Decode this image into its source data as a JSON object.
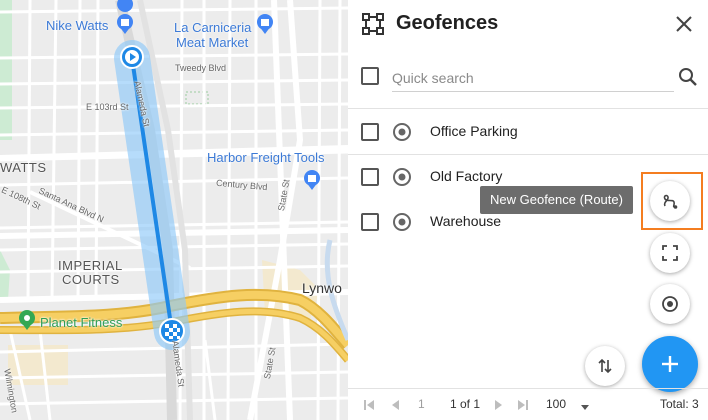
{
  "map": {
    "poi": {
      "nike": "Nike Watts",
      "carniceria_line1": "La Carniceria",
      "carniceria_line2": "Meat Market",
      "harbor": "Harbor Freight Tools",
      "planet": "Planet Fitness"
    },
    "areas": {
      "watts": "WATTS",
      "imperial_line1": "IMPERIAL",
      "imperial_line2": "COURTS",
      "lynwood": "Lynwo"
    },
    "streets": {
      "tweedy": "Tweedy Blvd",
      "e103": "E 103rd St",
      "century": "Century Blvd",
      "state1": "State St",
      "state2": "State St",
      "e108": "E 108th St",
      "santa_ana": "Santa Ana Blvd N",
      "wilmington": "Wilmington",
      "alameda_top": "Alameda St",
      "alameda_bottom": "Alameda St"
    },
    "route_color": "#1e88e5",
    "route_buffer_color": "#90caf9"
  },
  "panel": {
    "title": "Geofences",
    "search": {
      "placeholder": "Quick search",
      "value": ""
    },
    "items": [
      {
        "name": "Office Parking"
      },
      {
        "name": "Old Factory"
      },
      {
        "name": "Warehouse"
      }
    ],
    "tooltip": "New Geofence (Route)",
    "icons": {
      "header": "geofence-polygon-icon",
      "close": "close-icon",
      "search": "search-icon",
      "route": "route-icon",
      "fullscreen": "fullscreen-icon",
      "target": "target-icon",
      "add": "add-icon",
      "sort": "sort-icon"
    },
    "highlight_color": "#f47d20",
    "accent_color": "#2196f3"
  },
  "pager": {
    "page_input": "1",
    "page_of": "1 of 1",
    "page_size": "100",
    "total": "Total: 3"
  }
}
